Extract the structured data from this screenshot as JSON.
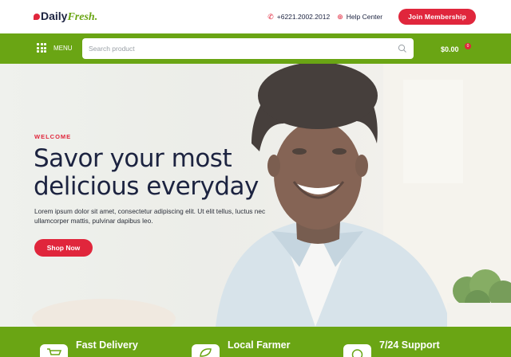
{
  "brand": {
    "name_part1": "Daily",
    "name_part2": "Fresh."
  },
  "header": {
    "phone": "+6221.2002.2012",
    "help": "Help Center",
    "join_label": "Join Membership"
  },
  "nav": {
    "menu_label": "MENU",
    "search_placeholder": "Search product",
    "cart_total": "$0.00",
    "cart_count": "0"
  },
  "hero": {
    "eyebrow": "WELCOME",
    "title": "Savor your most delicious everyday",
    "text": "Lorem ipsum dolor sit amet, consectetur adipiscing elit. Ut elit tellus, luctus nec ullamcorper mattis, pulvinar dapibus leo.",
    "button_label": "Shop Now"
  },
  "features": [
    {
      "label": "Fast Delivery",
      "icon": "cart-icon"
    },
    {
      "label": "Local Farmer",
      "icon": "leaf-icon"
    },
    {
      "label": "7/24 Support",
      "icon": "support-icon"
    }
  ],
  "colors": {
    "brand_green": "#6aa514",
    "accent_red": "#e0263c",
    "navy": "#1c2340"
  }
}
